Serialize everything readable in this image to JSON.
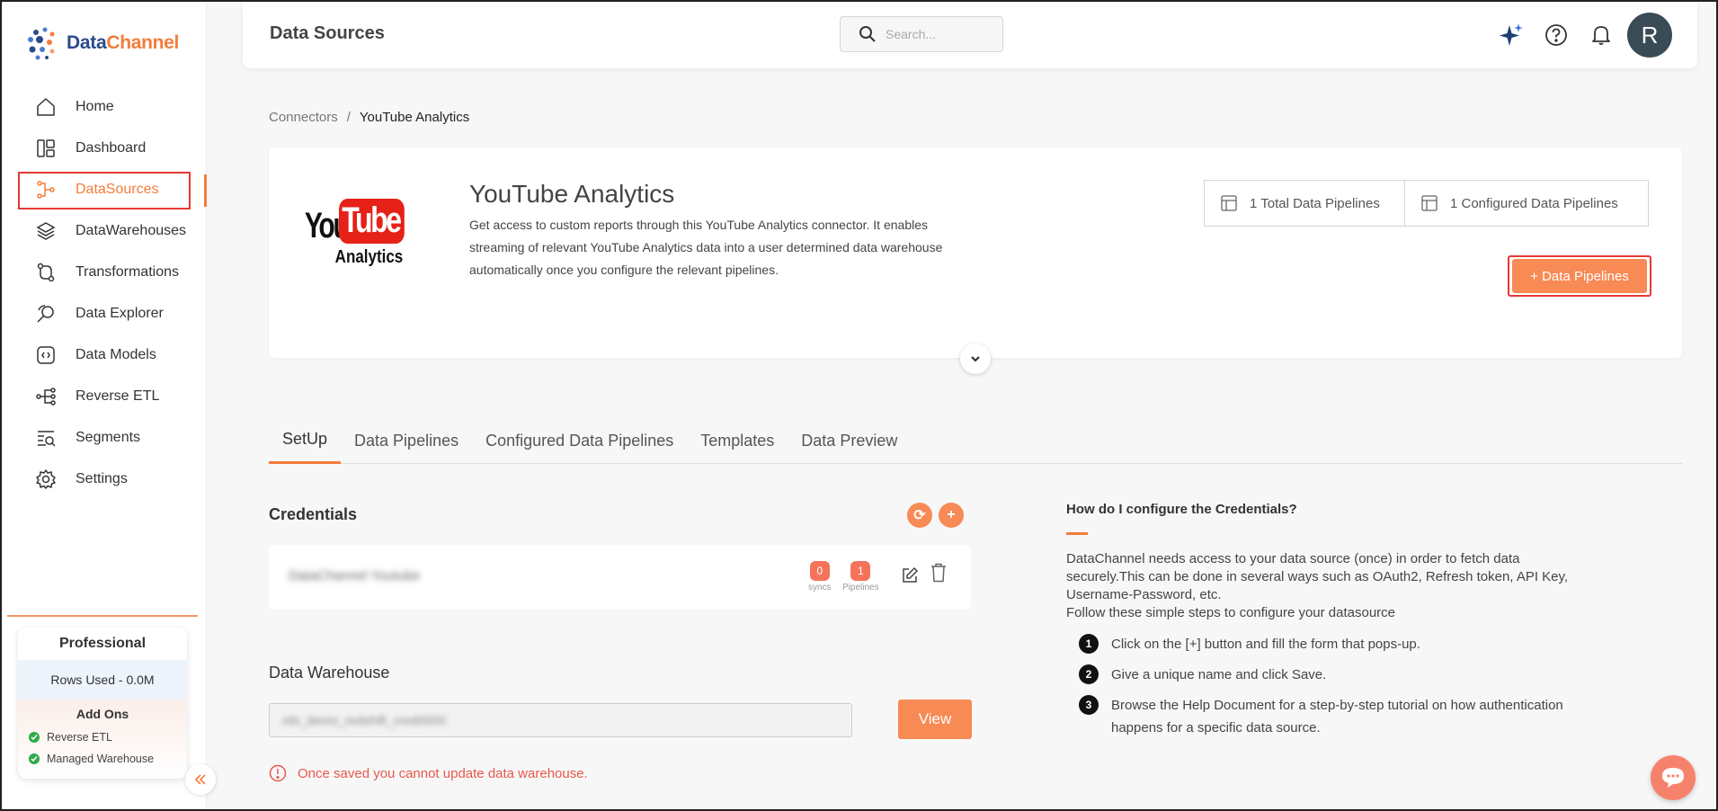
{
  "brand": {
    "name_part1": "Data",
    "name_part2": "Channel",
    "accent": "#f47c3c"
  },
  "sidebar": {
    "items": [
      {
        "label": "Home",
        "icon": "home-icon",
        "active": false
      },
      {
        "label": "Dashboard",
        "icon": "dashboard-icon",
        "active": false
      },
      {
        "label": "DataSources",
        "icon": "datasources-icon",
        "active": true
      },
      {
        "label": "DataWarehouses",
        "icon": "layers-icon",
        "active": false
      },
      {
        "label": "Transformations",
        "icon": "transformations-icon",
        "active": false
      },
      {
        "label": "Data Explorer",
        "icon": "explorer-icon",
        "active": false
      },
      {
        "label": "Data Models",
        "icon": "models-icon",
        "active": false
      },
      {
        "label": "Reverse ETL",
        "icon": "reverse-etl-icon",
        "active": false
      },
      {
        "label": "Segments",
        "icon": "segments-icon",
        "active": false
      },
      {
        "label": "Settings",
        "icon": "gear-icon",
        "active": false
      }
    ],
    "plan": {
      "title": "Professional",
      "rows_used": "Rows Used - 0.0M",
      "addons_title": "Add Ons",
      "addons": [
        "Reverse ETL",
        "Managed Warehouse"
      ]
    }
  },
  "header": {
    "title": "Data Sources",
    "search_placeholder": "Search...",
    "avatar_initial": "R"
  },
  "breadcrumb": {
    "parent": "Connectors",
    "separator": "/",
    "current": "YouTube Analytics"
  },
  "connector": {
    "logo_you": "You",
    "logo_tube": "Tube",
    "logo_analytics": "Analytics",
    "title": "YouTube Analytics",
    "description": "Get access to custom reports through this YouTube Analytics connector. It enables streaming of relevant YouTube Analytics data into a user determined data warehouse automatically once you configure the relevant pipelines.",
    "total_pipelines": "1 Total Data Pipelines",
    "configured_pipelines": "1 Configured Data Pipelines",
    "add_pipeline_label": "+ Data Pipelines"
  },
  "tabs": [
    {
      "label": "SetUp",
      "active": true
    },
    {
      "label": "Data Pipelines",
      "active": false
    },
    {
      "label": "Configured Data Pipelines",
      "active": false
    },
    {
      "label": "Templates",
      "active": false
    },
    {
      "label": "Data Preview",
      "active": false
    }
  ],
  "credentials": {
    "title": "Credentials",
    "refresh_symbol": "⟳",
    "add_symbol": "+",
    "row": {
      "name": "DataChannel Youtube",
      "syncs_count": "0",
      "syncs_label": "syncs",
      "pipelines_count": "1",
      "pipelines_label": "Pipelines"
    }
  },
  "warehouse": {
    "title": "Data Warehouse",
    "value": "rds_demo_redshift_cred0000",
    "view_label": "View",
    "warning": "Once saved you cannot update data warehouse."
  },
  "help": {
    "title": "How do I configure the Credentials?",
    "intro": "DataChannel needs access to your data source (once) in order to fetch data securely.This can be done in several ways such as OAuth2, Refresh token, API Key, Username-Password, etc.",
    "follow": "Follow these simple steps to configure your datasource",
    "steps": [
      {
        "n": "1",
        "text": "Click on the [+] button and fill the form that pops-up."
      },
      {
        "n": "2",
        "text": "Give a unique name and click Save."
      },
      {
        "n": "3",
        "text": "Browse the Help Document for a step-by-step tutorial on how authentication happens for a specific data source."
      }
    ]
  }
}
